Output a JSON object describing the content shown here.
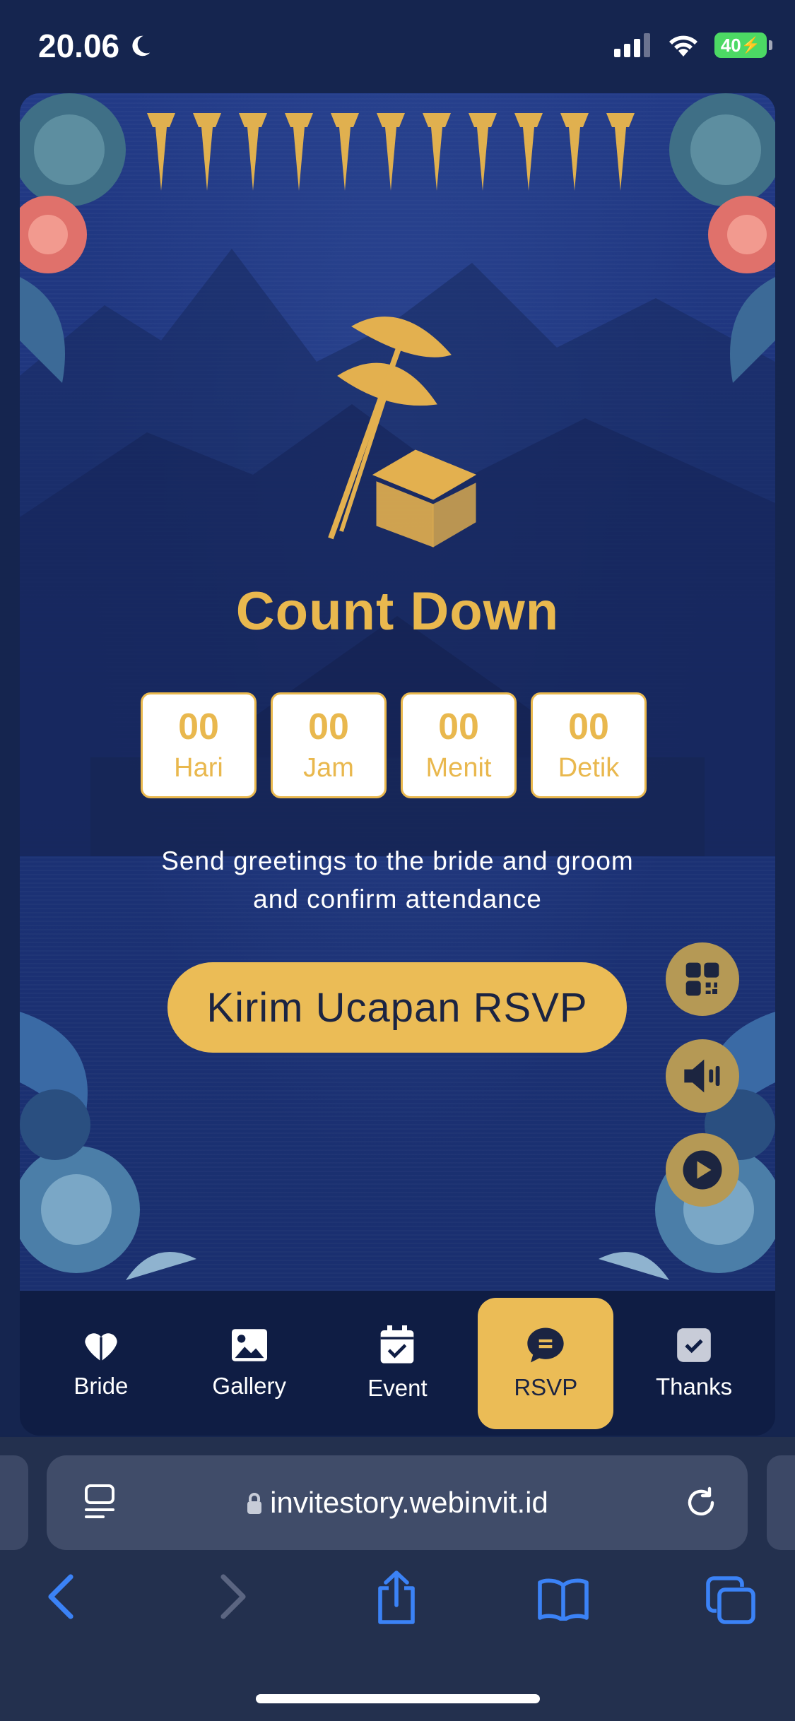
{
  "status_bar": {
    "time": "20.06",
    "battery": "40"
  },
  "card": {
    "title": "Count Down",
    "countdown": [
      {
        "value": "00",
        "label": "Hari"
      },
      {
        "value": "00",
        "label": "Jam"
      },
      {
        "value": "00",
        "label": "Menit"
      },
      {
        "value": "00",
        "label": "Detik"
      }
    ],
    "greeting_line1": "Send greetings to the bride and groom",
    "greeting_line2": "and confirm attendance",
    "rsvp_button": "Kirim Ucapan RSVP",
    "floating_buttons": [
      "qr-code-icon",
      "speaker-icon",
      "play-icon"
    ]
  },
  "nav": {
    "items": [
      {
        "label": "Bride",
        "icon": "heart-icon"
      },
      {
        "label": "Gallery",
        "icon": "image-icon"
      },
      {
        "label": "Event",
        "icon": "calendar-check-icon"
      },
      {
        "label": "RSVP",
        "icon": "chat-icon",
        "active": true
      },
      {
        "label": "Thanks",
        "icon": "check-square-icon"
      }
    ]
  },
  "browser": {
    "url": "invitestory.webinvit.id"
  },
  "colors": {
    "gold": "#ebbc56",
    "navy": "#1c3277",
    "nav_bg": "#0f1d44",
    "ios_blue": "#3b82f6"
  }
}
